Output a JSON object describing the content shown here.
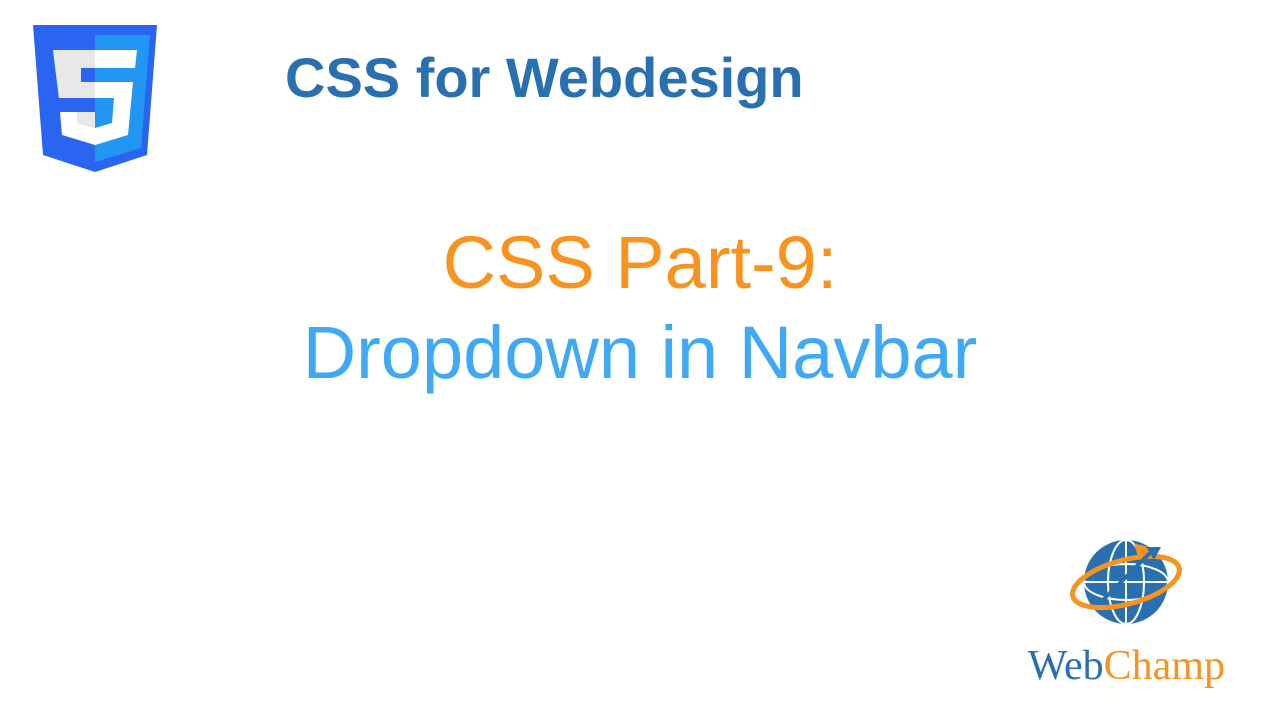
{
  "header": {
    "course_title": "CSS for Webdesign"
  },
  "main": {
    "part_label": "CSS Part-9:",
    "topic": "Dropdown in Navbar"
  },
  "brand": {
    "name_part1": "Web",
    "name_part2": "Champ"
  },
  "icons": {
    "logo": "css3-shield-icon",
    "globe": "globe-arrow-icon"
  },
  "colors": {
    "heading_blue": "#2970b1",
    "title_orange": "#f7931e",
    "subtitle_blue": "#3fa9f5"
  }
}
